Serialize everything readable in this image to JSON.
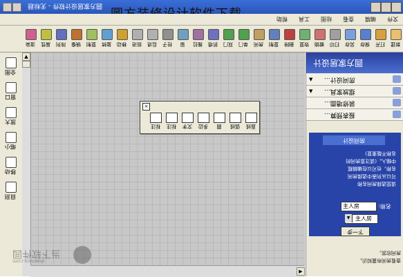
{
  "window": {
    "title": "圆方家居设计软件 - 无标题"
  },
  "overlay_title": "圆方装修设计软件下载",
  "menu": [
    "文件",
    "编辑",
    "查看",
    "绘图",
    "工具",
    "帮助"
  ],
  "toolbar": [
    {
      "label": "新建",
      "icon": "new-icon"
    },
    {
      "label": "打开",
      "icon": "open-icon"
    },
    {
      "label": "保存",
      "icon": "save-icon"
    },
    {
      "label": "另存",
      "icon": "save-as-icon"
    },
    {
      "label": "打印",
      "icon": "print-icon"
    },
    {
      "label": "撤销",
      "icon": "undo-icon"
    },
    {
      "label": "恢复",
      "icon": "redo-icon"
    },
    {
      "label": "删除",
      "icon": "delete-icon"
    },
    {
      "label": "复制",
      "icon": "copy-icon"
    },
    {
      "label": "房间",
      "icon": "room-icon"
    },
    {
      "label": "单门",
      "icon": "single-door-icon"
    },
    {
      "label": "双门",
      "icon": "double-door-icon"
    },
    {
      "label": "折墙",
      "icon": "wall-icon"
    },
    {
      "label": "推拉",
      "icon": "sliding-icon"
    },
    {
      "label": "窗",
      "icon": "window-icon"
    },
    {
      "label": "柱子",
      "icon": "pillar-icon"
    },
    {
      "label": "后退",
      "icon": "back-icon"
    },
    {
      "label": "前进",
      "icon": "forward-icon"
    },
    {
      "label": "移动",
      "icon": "move-icon"
    },
    {
      "label": "旋转",
      "icon": "rotate-icon"
    },
    {
      "label": "复制",
      "icon": "duplicate-icon"
    },
    {
      "label": "镜像",
      "icon": "mirror-icon"
    },
    {
      "label": "阵列",
      "icon": "array-icon"
    },
    {
      "label": "属性",
      "icon": "properties-icon"
    },
    {
      "label": "渲染",
      "icon": "render-icon"
    }
  ],
  "left_tools": [
    {
      "label": "全图",
      "icon": "full-view-icon"
    },
    {
      "label": "窗口",
      "icon": "window-zoom-icon"
    },
    {
      "label": "放大",
      "icon": "zoom-in-icon"
    },
    {
      "label": "缩小",
      "icon": "zoom-out-icon"
    },
    {
      "label": "移动",
      "icon": "pan-icon"
    },
    {
      "label": "目测",
      "icon": "view-icon"
    }
  ],
  "palette": {
    "tools": [
      {
        "label": "直线",
        "icon": "line-icon"
      },
      {
        "label": "弧线",
        "icon": "arc-icon"
      },
      {
        "label": "圆",
        "icon": "circle-icon"
      },
      {
        "label": "多边",
        "icon": "polygon-icon"
      },
      {
        "label": "文字",
        "icon": "text-icon"
      },
      {
        "label": "标注",
        "icon": "dimension-icon"
      },
      {
        "label": "标注",
        "icon": "annotate-icon"
      }
    ]
  },
  "right_panel": {
    "header": "圆方家居设计",
    "items": [
      {
        "label": "房间设计..."
      },
      {
        "label": "摆放家具..."
      },
      {
        "label": "装修墙面..."
      },
      {
        "label": "报表预算..."
      }
    ],
    "section_label": "房间设计",
    "instructions": "请您选择房间名称\n可以从列表中选择房间\n名称，也可以在编辑框\n中输入。(请注意房间的\n名称不能重复)",
    "name_label": "名称:",
    "name_value": "主人房",
    "select_value": "主人房",
    "next_button": "下一步",
    "footer": "查看房间布置知识。\n房间欣赏。"
  },
  "watermark": {
    "title": "当下软件园",
    "sub": "downxia.com"
  }
}
